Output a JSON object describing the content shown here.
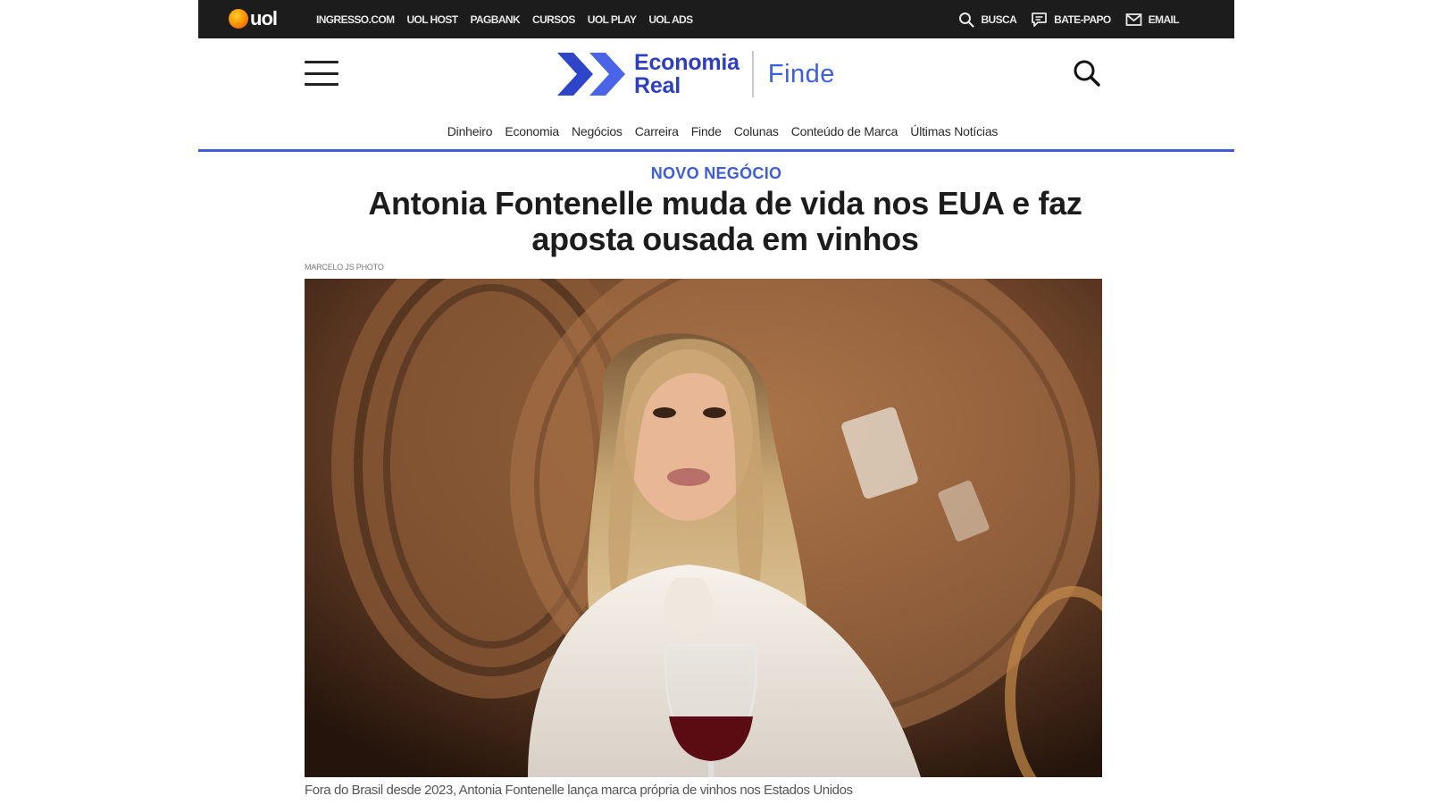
{
  "topbar": {
    "logo_text": "uol",
    "links": [
      "INGRESSO.COM",
      "UOL HOST",
      "PAGBANK",
      "CURSOS",
      "UOL PLAY",
      "UOL ADS"
    ],
    "search_label": "BUSCA",
    "chat_label": "BATE-PAPO",
    "email_label": "EMAIL"
  },
  "brand": {
    "name_line1": "Economia",
    "name_line2": "Real",
    "section": "Finde",
    "accent_color": "#3f5dd8",
    "icons": [
      "menu-icon",
      "search-icon"
    ]
  },
  "section_nav": [
    "Dinheiro",
    "Economia",
    "Negócios",
    "Carreira",
    "Finde",
    "Colunas",
    "Conteúdo de Marca",
    "Últimas Notícias"
  ],
  "article": {
    "kicker": "NOVO NEGÓCIO",
    "headline": "Antonia Fontenelle muda de vida nos EUA e faz aposta ousada em vinhos",
    "photo_credit": "MARCELO JS PHOTO",
    "caption": "Fora do Brasil desde 2023, Antonia Fontenelle lança marca própria de vinhos nos Estados Unidos"
  }
}
